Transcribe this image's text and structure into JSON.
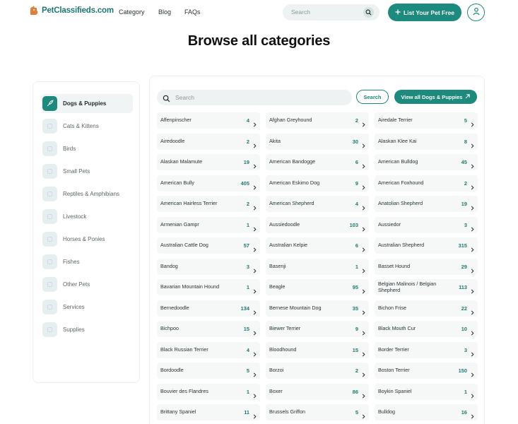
{
  "header": {
    "logo_text": "PetClassifieds.com",
    "nav": [
      "Category",
      "Blog",
      "FAQs"
    ],
    "search_placeholder": "Search",
    "cta_label": "List Your Pet Free"
  },
  "page_title": "Browse all categories",
  "sidebar": {
    "items": [
      {
        "label": "Dogs & Puppies",
        "active": true
      },
      {
        "label": "Cats & Kittens",
        "active": false
      },
      {
        "label": "Birds",
        "active": false
      },
      {
        "label": "Small Pets",
        "active": false
      },
      {
        "label": "Reptiles & Amphibians",
        "active": false
      },
      {
        "label": "Livestock",
        "active": false
      },
      {
        "label": "Horses & Ponies",
        "active": false
      },
      {
        "label": "Fishes",
        "active": false
      },
      {
        "label": "Other Pets",
        "active": false
      },
      {
        "label": "Services",
        "active": false
      },
      {
        "label": "Supplies",
        "active": false
      }
    ]
  },
  "main": {
    "search_placeholder": "Search",
    "search_button": "Search",
    "view_all_button": "View all Dogs & Puppies",
    "breeds": [
      {
        "name": "Affenpinscher",
        "count": "4"
      },
      {
        "name": "Afghan Greyhound",
        "count": "2"
      },
      {
        "name": "Airedale Terrier",
        "count": "5"
      },
      {
        "name": "Airedoodle",
        "count": "2"
      },
      {
        "name": "Akita",
        "count": "30"
      },
      {
        "name": "Alaskan Klee Kai",
        "count": "8"
      },
      {
        "name": "Alaskan Malamute",
        "count": "19"
      },
      {
        "name": "American Bandogge",
        "count": "6"
      },
      {
        "name": "American Bulldog",
        "count": "45"
      },
      {
        "name": "American Bully",
        "count": "405"
      },
      {
        "name": "American Eskimo Dog",
        "count": "9"
      },
      {
        "name": "American Foxhound",
        "count": "2"
      },
      {
        "name": "American Hairless Terrier",
        "count": "2"
      },
      {
        "name": "American Shepherd",
        "count": "4"
      },
      {
        "name": "Anatolian Shepherd",
        "count": "19"
      },
      {
        "name": "Armenian Gampr",
        "count": "1"
      },
      {
        "name": "Aussiedoodle",
        "count": "103"
      },
      {
        "name": "Aussiedor",
        "count": "3"
      },
      {
        "name": "Australian Cattle Dog",
        "count": "57"
      },
      {
        "name": "Australian Kelpie",
        "count": "6"
      },
      {
        "name": "Australian Shepherd",
        "count": "315"
      },
      {
        "name": "Bandog",
        "count": "3"
      },
      {
        "name": "Basenji",
        "count": "1"
      },
      {
        "name": "Basset Hound",
        "count": "29"
      },
      {
        "name": "Bavarian Mountain Hound",
        "count": "1"
      },
      {
        "name": "Beagle",
        "count": "95"
      },
      {
        "name": "Belgian Malinois / Belgian Shepherd",
        "count": "113"
      },
      {
        "name": "Bernedoodle",
        "count": "134"
      },
      {
        "name": "Bernese Mountain Dog",
        "count": "35"
      },
      {
        "name": "Bichon Frise",
        "count": "22"
      },
      {
        "name": "Bichpoo",
        "count": "15"
      },
      {
        "name": "Biewer Terrier",
        "count": "9"
      },
      {
        "name": "Black Mouth Cur",
        "count": "10"
      },
      {
        "name": "Black Russian Terrier",
        "count": "4"
      },
      {
        "name": "Bloodhound",
        "count": "15"
      },
      {
        "name": "Border Terrier",
        "count": "3"
      },
      {
        "name": "Bordoodle",
        "count": "5"
      },
      {
        "name": "Borzoi",
        "count": "2"
      },
      {
        "name": "Boston Terrier",
        "count": "150"
      },
      {
        "name": "Bouvier des Flandres",
        "count": "1"
      },
      {
        "name": "Boxer",
        "count": "86"
      },
      {
        "name": "Boykin Spaniel",
        "count": "1"
      },
      {
        "name": "Brittany Spaniel",
        "count": "11"
      },
      {
        "name": "Brussels Griffon",
        "count": "5"
      },
      {
        "name": "Bulldog",
        "count": "16"
      }
    ]
  },
  "colors": {
    "accent": "#1c8a7c",
    "accent_text": "#1c7b70",
    "cell_bg": "#f6f8f8"
  }
}
